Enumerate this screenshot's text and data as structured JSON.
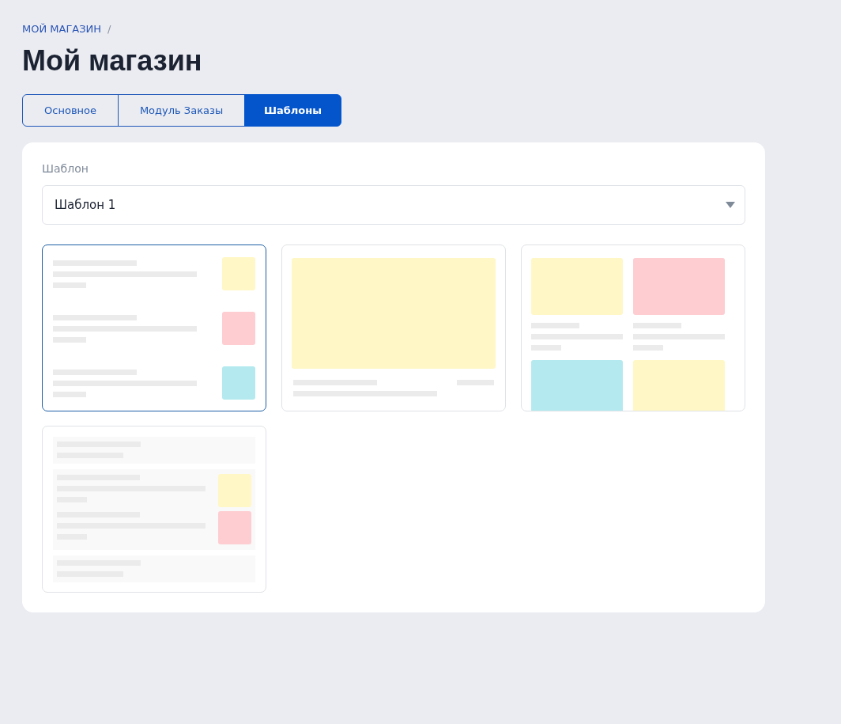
{
  "breadcrumbs": [
    {
      "label": "МОЙ МАГАЗИН",
      "separator": "/"
    }
  ],
  "title": "Мой магазин",
  "tabs": [
    {
      "label": "Основное",
      "selected": false
    },
    {
      "label": "Модуль Заказы",
      "selected": false
    },
    {
      "label": "Шаблоны",
      "selected": true
    }
  ],
  "template_field": {
    "label": "Шаблон",
    "value": "Шаблон 1"
  },
  "templates": [
    {
      "kind": "list",
      "selected": true
    },
    {
      "kind": "hero",
      "selected": false
    },
    {
      "kind": "grid",
      "selected": false
    },
    {
      "kind": "sections",
      "selected": false
    }
  ]
}
